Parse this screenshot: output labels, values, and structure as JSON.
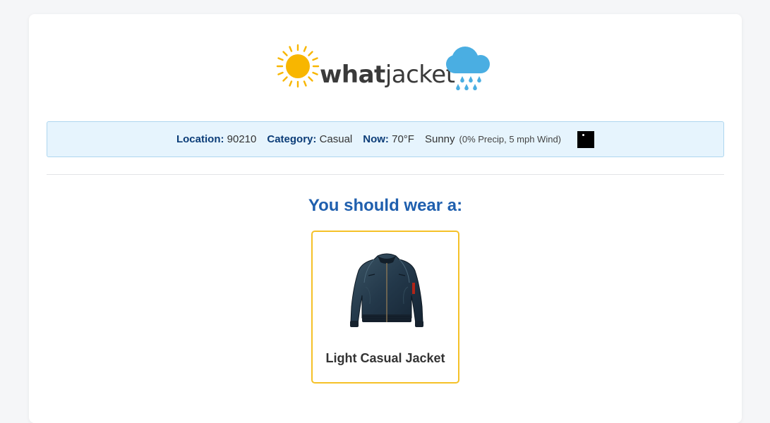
{
  "brand": {
    "word_what": "what",
    "word_jacket": "jacket"
  },
  "info_bar": {
    "location_label": "Location:",
    "location_value": "90210",
    "category_label": "Category:",
    "category_value": "Casual",
    "now_label": "Now:",
    "now_temp": "70°F",
    "condition": "Sunny",
    "details": "(0% Precip, 5 mph Wind)",
    "weather_icon": "weather-condition-icon"
  },
  "main": {
    "heading": "You should wear a:",
    "recommendation": {
      "name": "Light Casual Jacket",
      "image": "bomber-jacket-image"
    }
  },
  "colors": {
    "accent_blue": "#1f5fae",
    "label_navy": "#0c3d78",
    "info_bg": "#e6f4fd",
    "card_border": "#f5c128",
    "sun": "#f8b600",
    "cloud": "#4aaee2",
    "logo_text": "#3a3a3a"
  }
}
